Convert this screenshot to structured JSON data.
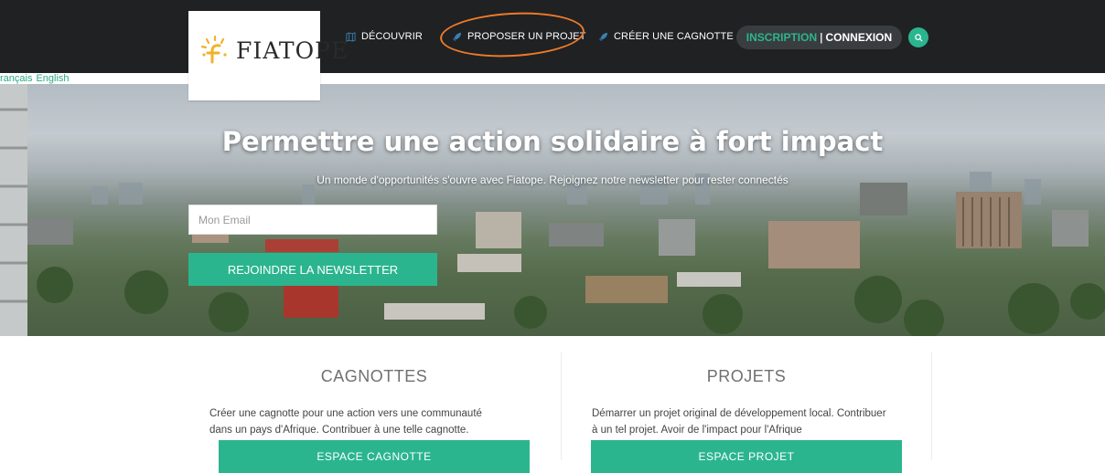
{
  "header": {
    "logo_text": "FIATOPE",
    "nav": [
      {
        "label": "DÉCOUVRIR",
        "icon": "map-icon"
      },
      {
        "label": "PROPOSER UN PROJET",
        "icon": "rocket-icon"
      },
      {
        "label": "CRÉER UNE CAGNOTTE",
        "icon": "rocket-icon"
      }
    ],
    "auth": {
      "signup": "INSCRIPTION",
      "separator": "|",
      "login": "CONNEXION"
    },
    "search_icon": "search-icon"
  },
  "languages": [
    "rançais",
    "English"
  ],
  "hero": {
    "title": "Permettre une action solidaire à fort impact",
    "subtitle": "Un monde d'opportunités s'ouvre avec Fiatope. Rejoignez notre newsletter pour rester connectés",
    "email_placeholder": "Mon Email",
    "button": "REJOINDRE LA NEWSLETTER"
  },
  "columns": [
    {
      "title": "CAGNOTTES",
      "text": "Créer une cagnotte pour une action vers une communauté dans un pays d'Afrique. Contribuer à une telle cagnotte.",
      "button": "ESPACE CAGNOTTE"
    },
    {
      "title": "PROJETS",
      "text": "Démarrer un projet original de développement local. Contribuer à un tel projet. Avoir de l'impact pour l'Afrique",
      "button": "ESPACE PROJET"
    }
  ],
  "colors": {
    "topbar": "#1f2123",
    "accent": "#2bb58f",
    "highlight": "#ee7a28",
    "link": "#2aa985"
  }
}
